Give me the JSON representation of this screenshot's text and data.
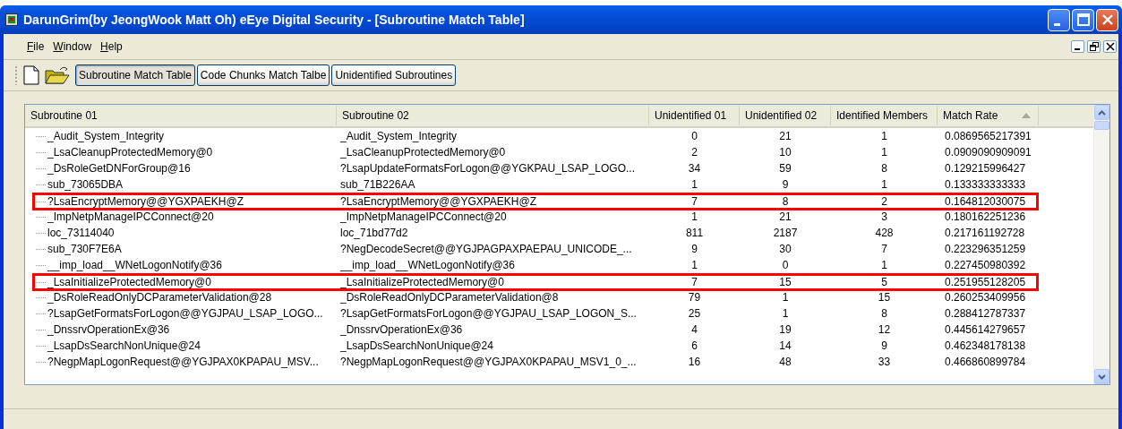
{
  "window": {
    "title": "DarunGrim(by JeongWook Matt Oh) eEye Digital Security - [Subroutine Match Table]"
  },
  "menu": [
    "File",
    "Window",
    "Help"
  ],
  "toolbar": {
    "buttons": [
      {
        "label": "Subroutine Match Table",
        "selected": true
      },
      {
        "label": "Code Chunks Match Talbe",
        "selected": false
      },
      {
        "label": "Unidentified Subroutines",
        "selected": false
      }
    ]
  },
  "table": {
    "columns": [
      {
        "label": "Subroutine 01",
        "sorted": false
      },
      {
        "label": "Subroutine 02",
        "sorted": false
      },
      {
        "label": "Unidentified 01",
        "sorted": false
      },
      {
        "label": "Unidentified 02",
        "sorted": false
      },
      {
        "label": "Identified Members",
        "sorted": false
      },
      {
        "label": "Match Rate",
        "sorted": true
      }
    ],
    "rows": [
      {
        "cells": [
          "_Audit_System_Integrity",
          "_Audit_System_Integrity",
          "0",
          "21",
          "1",
          "0.0869565217391"
        ],
        "highlighted": false
      },
      {
        "cells": [
          "_LsaCleanupProtectedMemory@0",
          "_LsaCleanupProtectedMemory@0",
          "2",
          "10",
          "1",
          "0.0909090909091"
        ],
        "highlighted": false
      },
      {
        "cells": [
          "_DsRoleGetDNForGroup@16",
          "?LsapUpdateFormatsForLogon@@YGKPAU_LSAP_LOGO...",
          "34",
          "59",
          "8",
          "0.129215996427"
        ],
        "highlighted": false
      },
      {
        "cells": [
          "sub_73065DBA",
          "sub_71B226AA",
          "1",
          "9",
          "1",
          "0.133333333333"
        ],
        "highlighted": false
      },
      {
        "cells": [
          "?LsaEncryptMemory@@YGXPAEKH@Z",
          "?LsaEncryptMemory@@YGXPAEKH@Z",
          "7",
          "8",
          "2",
          "0.164812030075"
        ],
        "highlighted": true
      },
      {
        "cells": [
          "_ImpNetpManageIPCConnect@20",
          "_ImpNetpManageIPCConnect@20",
          "1",
          "21",
          "3",
          "0.180162251236"
        ],
        "highlighted": false
      },
      {
        "cells": [
          "loc_73114040",
          "loc_71bd77d2",
          "811",
          "2187",
          "428",
          "0.217161192728"
        ],
        "highlighted": false
      },
      {
        "cells": [
          "sub_730F7E6A",
          "?NegDecodeSecret@@YGJPAGPAXPAEPAU_UNICODE_...",
          "9",
          "30",
          "7",
          "0.223296351259"
        ],
        "highlighted": false
      },
      {
        "cells": [
          "__imp_load__WNetLogonNotify@36",
          "__imp_load__WNetLogonNotify@36",
          "1",
          "0",
          "1",
          "0.227450980392"
        ],
        "highlighted": false
      },
      {
        "cells": [
          "_LsaInitializeProtectedMemory@0",
          "_LsaInitializeProtectedMemory@0",
          "7",
          "15",
          "5",
          "0.251955128205"
        ],
        "highlighted": true
      },
      {
        "cells": [
          "_DsRoleReadOnlyDCParameterValidation@28",
          "_DsRoleReadOnlyDCParameterValidation@8",
          "79",
          "1",
          "15",
          "0.260253409956"
        ],
        "highlighted": false
      },
      {
        "cells": [
          "?LsapGetFormatsForLogon@@YGJPAU_LSAP_LOGO...",
          "?LsapGetFormatsForLogon@@YGJPAU_LSAP_LOGON_S...",
          "25",
          "1",
          "8",
          "0.288412787337"
        ],
        "highlighted": false
      },
      {
        "cells": [
          "_DnssrvOperationEx@36",
          "_DnssrvOperationEx@36",
          "4",
          "19",
          "12",
          "0.445614279657"
        ],
        "highlighted": false
      },
      {
        "cells": [
          "_LsapDsSearchNonUnique@24",
          "_LsapDsSearchNonUnique@24",
          "6",
          "14",
          "9",
          "0.462348178138"
        ],
        "highlighted": false
      },
      {
        "cells": [
          "?NegpMapLogonRequest@@YGJPAX0KPAPAU_MSV...",
          "?NegpMapLogonRequest@@YGJPAX0KPAPAU_MSV1_0_...",
          "16",
          "48",
          "33",
          "0.466860899784"
        ],
        "highlighted": false
      }
    ]
  }
}
